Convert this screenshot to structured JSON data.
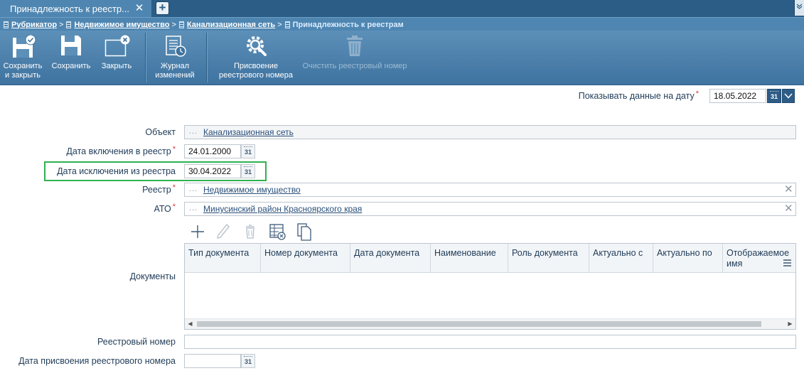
{
  "tab": {
    "title": "Принадлежность к реестр...",
    "close_glyph": "✕",
    "add_glyph": "+"
  },
  "breadcrumb": {
    "items": [
      "Рубрикатор",
      "Недвижимое имущество",
      "Канализационная сеть"
    ],
    "separator": ">",
    "current": "Принадлежность к реестрам"
  },
  "toolbar": {
    "save_close": [
      "Сохранить",
      "и закрыть"
    ],
    "save": "Сохранить",
    "close": "Закрыть",
    "journal": [
      "Журнал",
      "изменений"
    ],
    "assign": [
      "Присвоение",
      "реестрового номера"
    ],
    "clear": "Очистить реестровый номер"
  },
  "show_date": {
    "label": "Показывать данные на дату",
    "value": "18.05.2022",
    "cal_text": "31"
  },
  "form": {
    "object": {
      "label": "Объект",
      "value": "Канализационная сеть"
    },
    "date_in": {
      "label": "Дата включения в реестр",
      "value": "24.01.2000"
    },
    "date_out": {
      "label": "Дата исключения из реестра",
      "value": "30.04.2022"
    },
    "registry": {
      "label": "Реестр",
      "value": "Недвижимое имущество"
    },
    "ato": {
      "label": "АТО",
      "value": "Минусинский район Красноярского края"
    },
    "documents_label": "Документы",
    "reg_number": {
      "label": "Реестровый номер",
      "value": ""
    },
    "reg_date": {
      "label": "Дата присвоения реестрового номера",
      "value": ""
    },
    "dots": "...",
    "cal_text": "31",
    "clear_glyph": "✕",
    "required_mark": "*"
  },
  "grid": {
    "columns": [
      "Тип документа",
      "Номер документа",
      "Дата документа",
      "Наименование",
      "Роль документа",
      "Актуально с",
      "Актуально по",
      "Отображаемое имя"
    ],
    "rows": []
  },
  "colors": {
    "accent": "#4f86b1",
    "toolbar": "#3f73a0",
    "highlight": "#2fb150",
    "required": "#d23c3c"
  }
}
